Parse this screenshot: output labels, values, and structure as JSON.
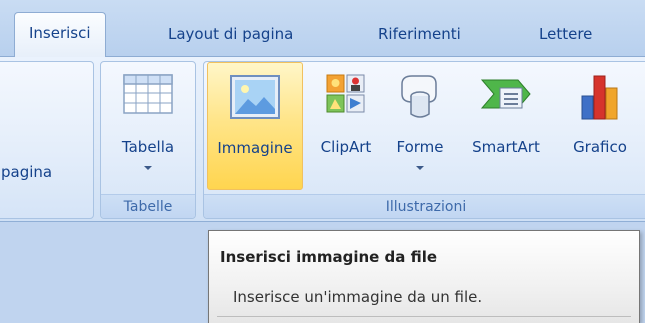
{
  "tabs": [
    {
      "label": "Inserisci",
      "active": true
    },
    {
      "label": "Layout di pagina"
    },
    {
      "label": "Riferimenti"
    },
    {
      "label": "Lettere"
    }
  ],
  "ribbon": {
    "partial_group_button": "pagina",
    "groups": {
      "tabelle": {
        "label": "Tabelle",
        "buttons": [
          {
            "label": "Tabella",
            "icon": "table-icon",
            "dropdown": true
          }
        ]
      },
      "illustrazioni": {
        "label": "Illustrazioni",
        "buttons": [
          {
            "label": "Immagine",
            "icon": "picture-icon",
            "highlighted": true
          },
          {
            "label": "ClipArt",
            "icon": "clipart-icon"
          },
          {
            "label": "Forme",
            "icon": "shapes-icon",
            "dropdown": true
          },
          {
            "label": "SmartArt",
            "icon": "smartart-icon"
          },
          {
            "label": "Grafico",
            "icon": "chart-icon"
          }
        ]
      }
    }
  },
  "tooltip": {
    "title": "Inserisci immagine da file",
    "body": "Inserisce un'immagine da un file."
  },
  "colors": {
    "ribbon_text": "#15428b",
    "hover_highlight": "#ffd54f",
    "tab_strip": "#bfd5f0"
  }
}
